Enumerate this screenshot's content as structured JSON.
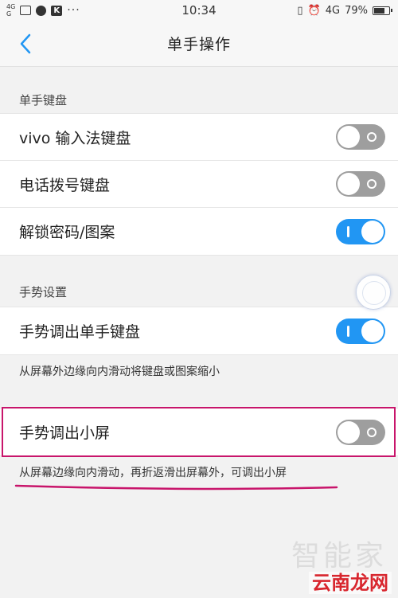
{
  "status_bar": {
    "signal1": "4G",
    "signal2": "G",
    "time": "10:34",
    "network": "4G",
    "battery": "79%",
    "battery_level": 0.79
  },
  "header": {
    "title": "单手操作"
  },
  "sections": [
    {
      "title": "单手键盘",
      "items": [
        {
          "label": "vivo 输入法键盘",
          "on": false
        },
        {
          "label": "电话拨号键盘",
          "on": false
        },
        {
          "label": "解锁密码/图案",
          "on": true
        }
      ]
    },
    {
      "title": "手势设置",
      "items": [
        {
          "label": "手势调出单手键盘",
          "on": true,
          "description": "从屏幕外边缘向内滑动将键盘或图案缩小"
        },
        {
          "label": "手势调出小屏",
          "on": false,
          "description": "从屏幕边缘向内滑动，再折返滑出屏幕外，可调出小屏"
        }
      ]
    }
  ],
  "watermark": {
    "faint": "智能家",
    "main": "云南龙网"
  },
  "colors": {
    "toggle_on": "#2196f3",
    "toggle_off": "#9e9e9e",
    "annotation": "#c8156b",
    "watermark": "#d8262e"
  }
}
